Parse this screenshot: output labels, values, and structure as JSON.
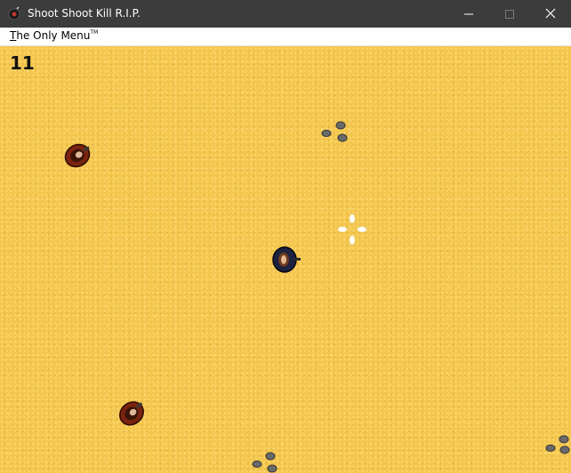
{
  "window": {
    "title": "Shoot Shoot Kill R.I.P.",
    "icon": "bomb-icon",
    "controls": [
      "minimize-icon",
      "maximize-icon",
      "close-icon"
    ],
    "titlebar_color": "#3c3c3c"
  },
  "menubar": {
    "menu_accel": "T",
    "menu_rest": "he Only Menu",
    "menu_tm": "TM"
  },
  "game": {
    "score": "11",
    "ground_color": "#f4c64e",
    "player": {
      "icon": "player-icon",
      "color": "#1c2240"
    },
    "enemies": [
      {
        "icon": "enemy-icon",
        "color": "#7a2410"
      },
      {
        "icon": "enemy-icon",
        "color": "#7a2410"
      }
    ],
    "crosshair": {
      "icon": "crosshair-icon",
      "color": "#ffffff"
    },
    "rocks": {
      "icon": "rock-icon",
      "color": "#5e5e5e",
      "clusters": 3
    }
  }
}
